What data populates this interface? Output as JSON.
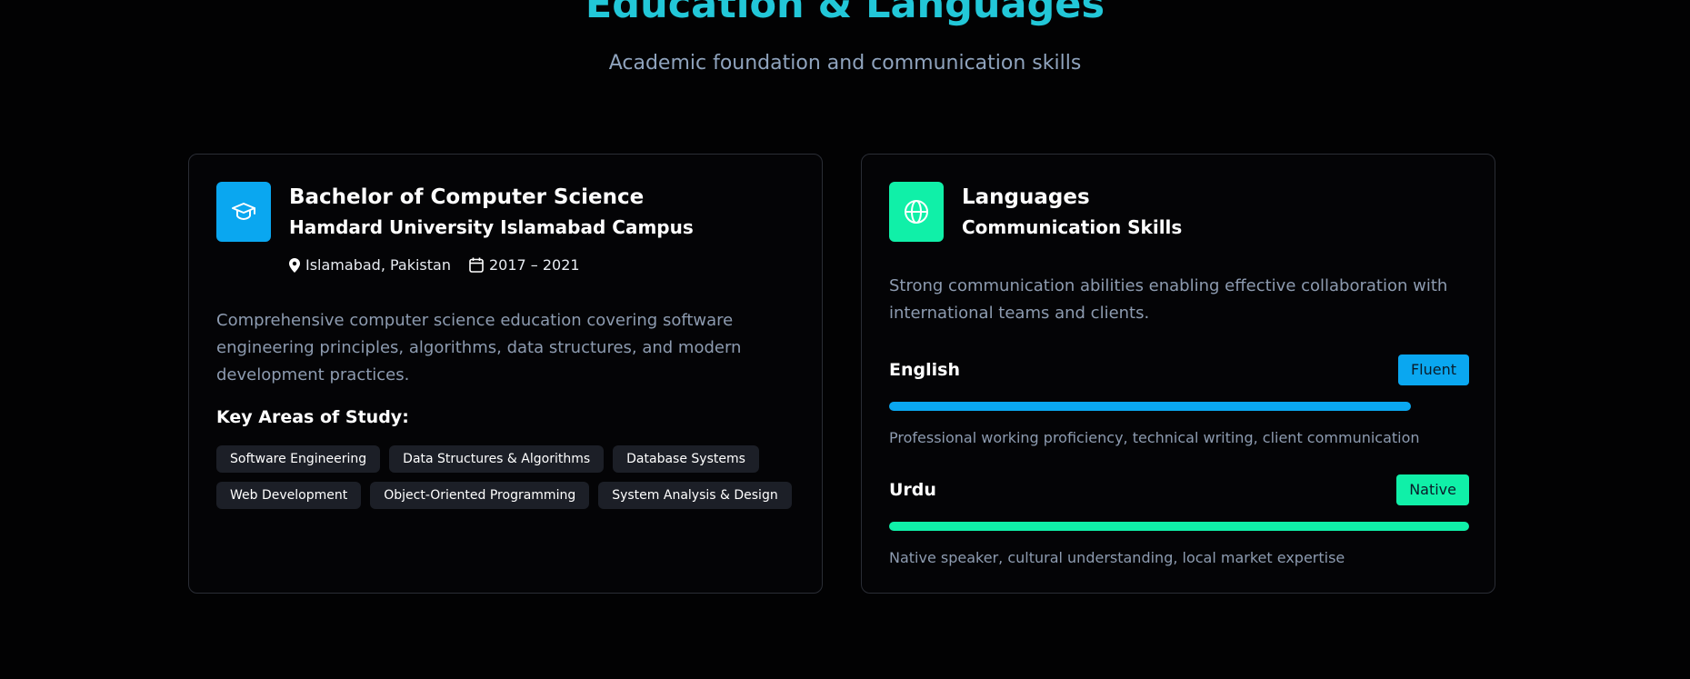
{
  "header": {
    "title": "Education & Languages",
    "subtitle": "Academic foundation and communication skills"
  },
  "education": {
    "icon": "graduation-cap-icon",
    "degree": "Bachelor of Computer Science",
    "institution": "Hamdard University Islamabad Campus",
    "location": "Islamabad, Pakistan",
    "period": "2017 – 2021",
    "description": "Comprehensive computer science education covering software engineering principles, algorithms, data structures, and modern development practices.",
    "areas_heading": "Key Areas of Study:",
    "areas": [
      "Software Engineering",
      "Data Structures & Algorithms",
      "Database Systems",
      "Web Development",
      "Object-Oriented Programming",
      "System Analysis & Design"
    ]
  },
  "languages": {
    "icon": "globe-icon",
    "title": "Languages",
    "subtitle": "Communication Skills",
    "description": "Strong communication abilities enabling effective collaboration with international teams and clients.",
    "items": [
      {
        "name": "English",
        "level": "Fluent",
        "proficiency": 0.9,
        "note": "Professional working proficiency, technical writing, client communication"
      },
      {
        "name": "Urdu",
        "level": "Native",
        "proficiency": 1.0,
        "note": "Native speaker, cultural understanding, local market expertise"
      }
    ]
  },
  "colors": {
    "accent_title": "#22c7d8",
    "education_accent": "#0aa7f0",
    "languages_accent": "#10f0a8"
  }
}
